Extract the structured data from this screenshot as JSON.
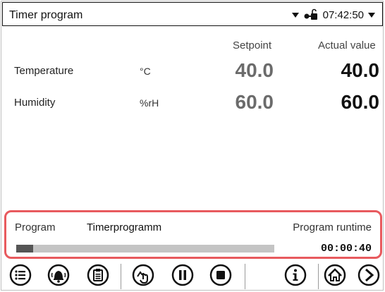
{
  "header": {
    "title": "Timer program",
    "time": "07:42:50"
  },
  "table": {
    "col_setpoint": "Setpoint",
    "col_actual": "Actual value",
    "rows": [
      {
        "label": "Temperature",
        "unit": "°C",
        "setpoint": "40.0",
        "actual": "40.0"
      },
      {
        "label": "Humidity",
        "unit": "%rH",
        "setpoint": "60.0",
        "actual": "60.0"
      }
    ]
  },
  "program": {
    "label": "Program",
    "name": "Timerprogramm",
    "runtime_label": "Program runtime",
    "runtime": "00:00:40",
    "progress_fraction": 0.065
  },
  "colors": {
    "highlight": "#e85a5e",
    "progress_fill": "#555555",
    "progress_track": "#c4c4c4"
  },
  "toolbar": {
    "buttons": [
      "menu-icon",
      "alarm-bell-icon",
      "clipboard-list-icon",
      "touch-program-icon",
      "pause-icon",
      "stop-icon",
      "info-icon",
      "home-icon",
      "next-arrow-icon"
    ]
  }
}
